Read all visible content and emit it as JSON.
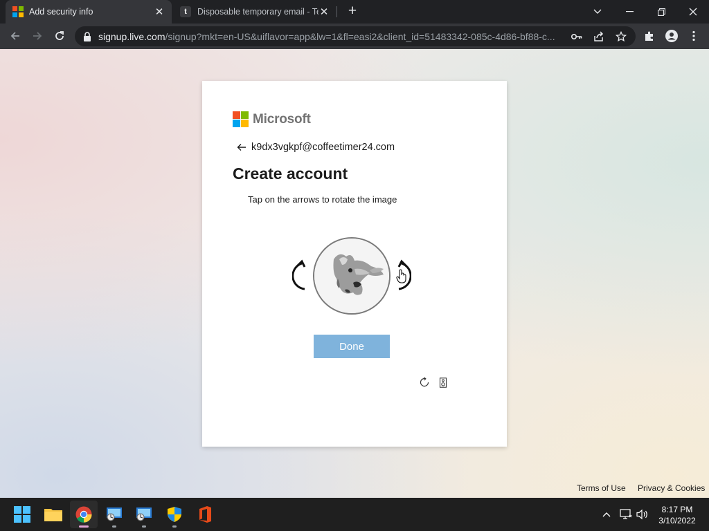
{
  "browser": {
    "tabs": [
      {
        "title": "Add security info",
        "active": true
      },
      {
        "title": "Disposable temporary email - Temp Mail",
        "favicon_letter": "t",
        "active": false
      }
    ],
    "url": {
      "host": "signup.live.com",
      "path": "/signup?mkt=en-US&uiflavor=app&lw=1&fl=easi2&client_id=51483342-085c-4d86-bf88-c..."
    }
  },
  "page": {
    "brand": "Microsoft",
    "email": "k9dx3vgkpf@coffeetimer24.com",
    "title": "Create account",
    "instruction": "Tap on the arrows to rotate the image",
    "done_label": "Done",
    "footer_links": [
      "Terms of Use",
      "Privacy & Cookies"
    ]
  },
  "taskbar": {
    "time": "8:17 PM",
    "date": "3/10/2022"
  },
  "colors": {
    "ms_red": "#f25022",
    "ms_green": "#7fba00",
    "ms_blue": "#00a4ef",
    "ms_yellow": "#ffb900",
    "done_button": "#7fb3dc"
  }
}
